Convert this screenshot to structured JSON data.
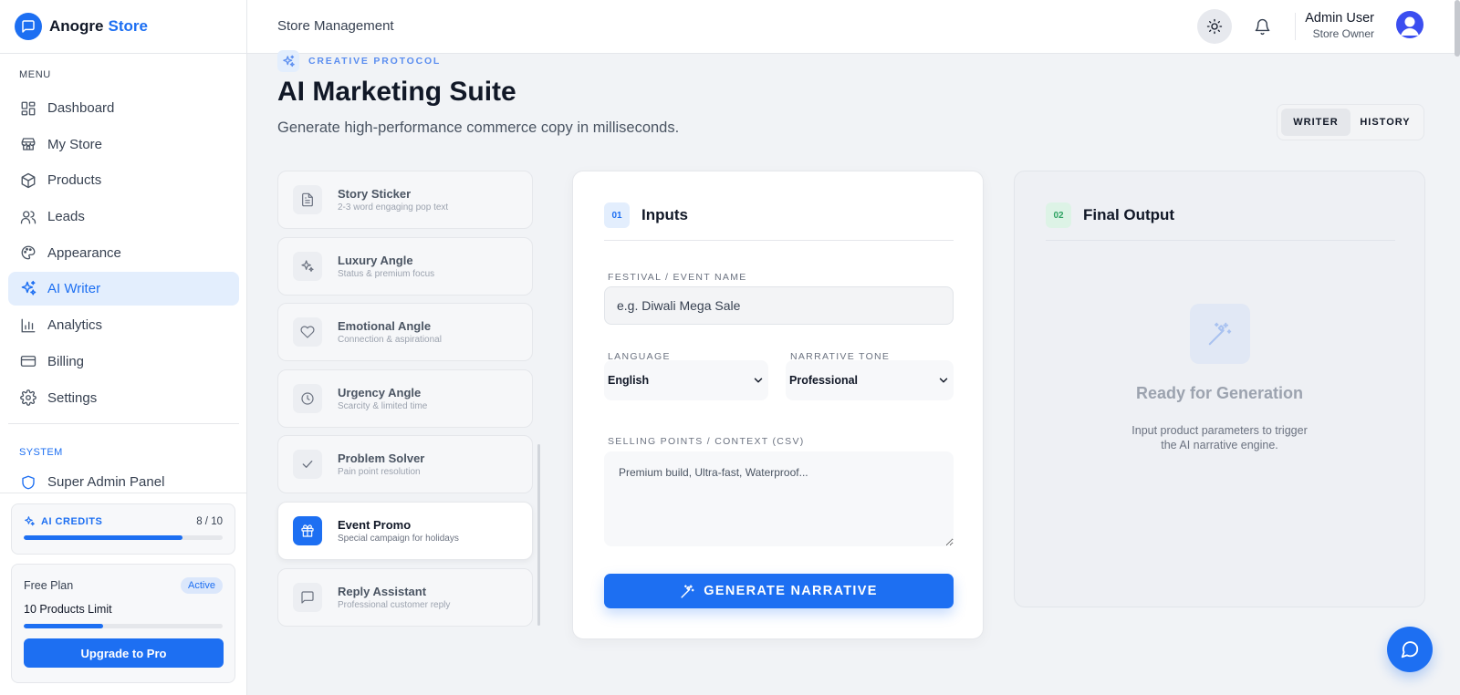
{
  "brand": {
    "name": "Anogre",
    "accent": "Store"
  },
  "sidebar": {
    "menu_label": "MENU",
    "items": [
      {
        "label": "Dashboard",
        "icon": "dashboard-icon"
      },
      {
        "label": "My Store",
        "icon": "store-icon"
      },
      {
        "label": "Products",
        "icon": "box-icon"
      },
      {
        "label": "Leads",
        "icon": "users-icon"
      },
      {
        "label": "Appearance",
        "icon": "palette-icon"
      },
      {
        "label": "AI Writer",
        "icon": "sparkles-icon",
        "active": true
      },
      {
        "label": "Analytics",
        "icon": "bar-chart-icon"
      },
      {
        "label": "Billing",
        "icon": "credit-card-icon"
      },
      {
        "label": "Settings",
        "icon": "gear-icon"
      }
    ],
    "system_label": "SYSTEM",
    "admin_item": "Super Admin Panel"
  },
  "credits": {
    "label": "AI CREDITS",
    "used": 8,
    "total": 10,
    "count_text": "8 / 10",
    "progress": 0.8
  },
  "plan": {
    "name": "Free Plan",
    "badge": "Active",
    "limit": "10 Products Limit",
    "progress": 0.4,
    "upgrade_label": "Upgrade to Pro"
  },
  "header": {
    "title": "Store Management",
    "user_name": "Admin User",
    "user_role": "Store Owner"
  },
  "page": {
    "eyebrow": "CREATIVE PROTOCOL",
    "title": "AI Marketing Suite",
    "subtitle": "Generate high-performance commerce copy in milliseconds.",
    "tabs": [
      "WRITER",
      "HISTORY"
    ],
    "active_tab": "WRITER"
  },
  "templates": [
    {
      "title": "Story Sticker",
      "sub": "2-3 word engaging pop text",
      "icon": "document-icon"
    },
    {
      "title": "Luxury Angle",
      "sub": "Status & premium focus",
      "icon": "sparkles-icon"
    },
    {
      "title": "Emotional Angle",
      "sub": "Connection & aspirational",
      "icon": "heart-icon"
    },
    {
      "title": "Urgency Angle",
      "sub": "Scarcity & limited time",
      "icon": "clock-icon"
    },
    {
      "title": "Problem Solver",
      "sub": "Pain point resolution",
      "icon": "check-icon"
    },
    {
      "title": "Event Promo",
      "sub": "Special campaign for holidays",
      "icon": "gift-icon",
      "active": true
    },
    {
      "title": "Reply Assistant",
      "sub": "Professional customer reply",
      "icon": "message-icon"
    }
  ],
  "inputs": {
    "step": "01",
    "title": "Inputs",
    "event_label": "FESTIVAL / EVENT NAME",
    "event_placeholder": "e.g. Diwali Mega Sale",
    "language_label": "LANGUAGE",
    "language_value": "English",
    "tone_label": "NARRATIVE TONE",
    "tone_value": "Professional",
    "context_label": "SELLING POINTS / CONTEXT (CSV)",
    "context_placeholder": "Premium build, Ultra-fast, Waterproof...",
    "generate_label": "GENERATE NARRATIVE"
  },
  "output": {
    "step": "02",
    "title": "Final Output",
    "placeholder_title": "Ready for Generation",
    "placeholder_sub": "Input product parameters to trigger the AI narrative engine."
  },
  "colors": {
    "accent": "#1d6ff2",
    "success": "#2fa363",
    "background": "#f1f3f6"
  }
}
